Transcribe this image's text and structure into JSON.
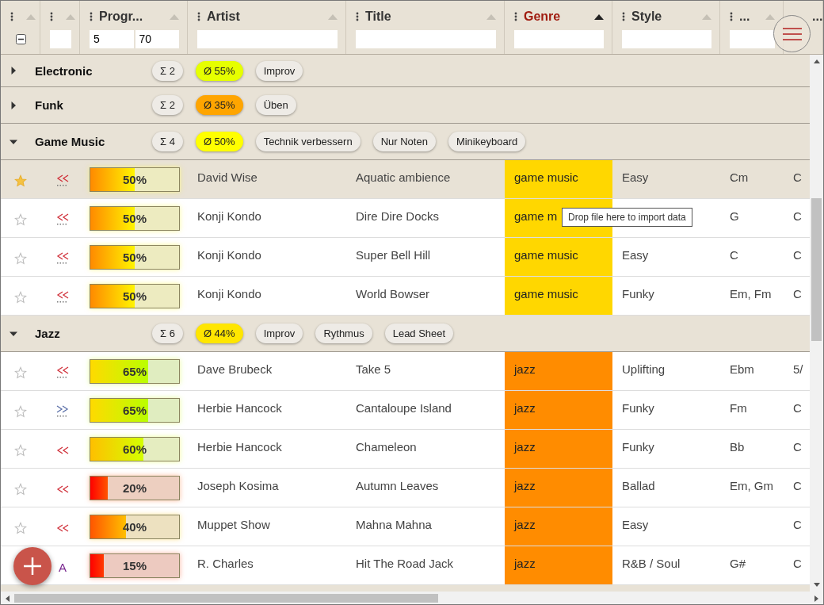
{
  "columns": [
    {
      "sorted": false,
      "kind": "checkbox",
      "indeterminate": true
    },
    {
      "sorted": false,
      "kind": "text"
    },
    {
      "label": "Progr...",
      "sorted": false,
      "kind": "range",
      "filter_values": [
        "5",
        "70"
      ]
    },
    {
      "label": "Artist",
      "sorted": false,
      "kind": "text"
    },
    {
      "label": "Title",
      "sorted": false,
      "kind": "text"
    },
    {
      "label": "Genre",
      "sorted": true,
      "kind": "text"
    },
    {
      "label": "Style",
      "sorted": false,
      "kind": "text"
    },
    {
      "label": "...",
      "sorted": false,
      "kind": "text"
    },
    {
      "label": "...",
      "sorted": false,
      "kind": "none"
    }
  ],
  "groups": [
    {
      "name": "Electronic",
      "expanded": false,
      "count": "Σ 2",
      "average": "Ø 55%",
      "color": "#e6ff00",
      "tags": [
        "Improv"
      ]
    },
    {
      "name": "Funk",
      "expanded": false,
      "count": "Σ 2",
      "average": "Ø 35%",
      "color": "#ffa500",
      "tags": [
        "Üben"
      ]
    },
    {
      "name": "Game Music",
      "expanded": true,
      "count": "Σ 4",
      "average": "Ø 50%",
      "color": "#ffff00",
      "tags": [
        "Technik verbessern",
        "Nur Noten",
        "Minikeyboard"
      ],
      "rows": [
        {
          "selected": true,
          "favorite": true,
          "icon": {
            "kind": "back",
            "dotted": true
          },
          "level": 0.5,
          "progress": "50%",
          "artist": "David Wise",
          "title": "Aquatic ambience",
          "genre": "game music",
          "color": "#ffd700",
          "style": "Easy",
          "key": "Cm",
          "column_9": "C"
        },
        {
          "selected": false,
          "favorite": false,
          "icon": {
            "kind": "back",
            "dotted": true
          },
          "level": 0.5,
          "progress": "50%",
          "artist": "Konji Kondo",
          "title": "Dire Dire Docks",
          "genre": "game m",
          "color": "#ffd700",
          "key": "G",
          "column_9": "C"
        },
        {
          "selected": false,
          "favorite": false,
          "icon": {
            "kind": "back",
            "dotted": true
          },
          "level": 0.5,
          "progress": "50%",
          "artist": "Konji Kondo",
          "title": "Super Bell Hill",
          "genre": "game music",
          "color": "#ffd700",
          "style": "Easy",
          "key": "C",
          "column_9": "C"
        },
        {
          "selected": false,
          "favorite": false,
          "icon": {
            "kind": "back",
            "dotted": true
          },
          "level": 0.5,
          "progress": "50%",
          "artist": "Konji Kondo",
          "title": "World Bowser",
          "genre": "game music",
          "color": "#ffd700",
          "style": "Funky",
          "key": "Em, Fm",
          "column_9": "C"
        }
      ]
    },
    {
      "name": "Jazz",
      "expanded": true,
      "count": "Σ 6",
      "average": "Ø 44%",
      "color": "#ffe600",
      "tags": [
        "Improv",
        "Rythmus",
        "Lead Sheet"
      ],
      "rows": [
        {
          "selected": false,
          "favorite": false,
          "icon": {
            "kind": "back",
            "dotted": true
          },
          "level": 0.65,
          "progress": "65%",
          "artist": "Dave Brubeck",
          "title": "Take 5",
          "genre": "jazz",
          "color": "#ff8c00",
          "style": "Uplifting",
          "key": "Ebm",
          "column_9": "5/"
        },
        {
          "selected": false,
          "favorite": false,
          "icon": {
            "kind": "forward",
            "dotted": true
          },
          "level": 0.65,
          "progress": "65%",
          "artist": "Herbie Hancock",
          "title": "Cantaloupe Island",
          "genre": "jazz",
          "color": "#ff8c00",
          "style": "Funky",
          "key": "Fm",
          "column_9": "C"
        },
        {
          "selected": false,
          "favorite": false,
          "icon": {
            "kind": "back",
            "dotted": false
          },
          "level": 0.6,
          "progress": "60%",
          "artist": "Herbie Hancock",
          "title": "Chameleon",
          "genre": "jazz",
          "color": "#ff8c00",
          "style": "Funky",
          "key": "Bb",
          "column_9": "C"
        },
        {
          "selected": false,
          "favorite": false,
          "icon": {
            "kind": "back",
            "dotted": false
          },
          "level": 0.2,
          "progress": "20%",
          "artist": "Joseph Kosima",
          "title": "Autumn Leaves",
          "genre": "jazz",
          "color": "#ff8c00",
          "style": "Ballad",
          "key": "Em, Gm",
          "column_9": "C"
        },
        {
          "selected": false,
          "favorite": false,
          "icon": {
            "kind": "back",
            "dotted": false
          },
          "level": 0.4,
          "progress": "40%",
          "artist": "Muppet Show",
          "title": "Mahna Mahna",
          "genre": "jazz",
          "color": "#ff8c00",
          "style": "Easy",
          "column_9": "C"
        },
        {
          "selected": false,
          "icon": {
            "kind": "letter",
            "text": "A"
          },
          "level": 0.15,
          "progress": "15%",
          "artist": "R. Charles",
          "title": "Hit The Road Jack",
          "genre": "jazz",
          "color": "#ff8c00",
          "style": "R&B / Soul",
          "key": "G#",
          "column_9": "C"
        }
      ]
    }
  ],
  "tooltip": "Drop file here to import data"
}
